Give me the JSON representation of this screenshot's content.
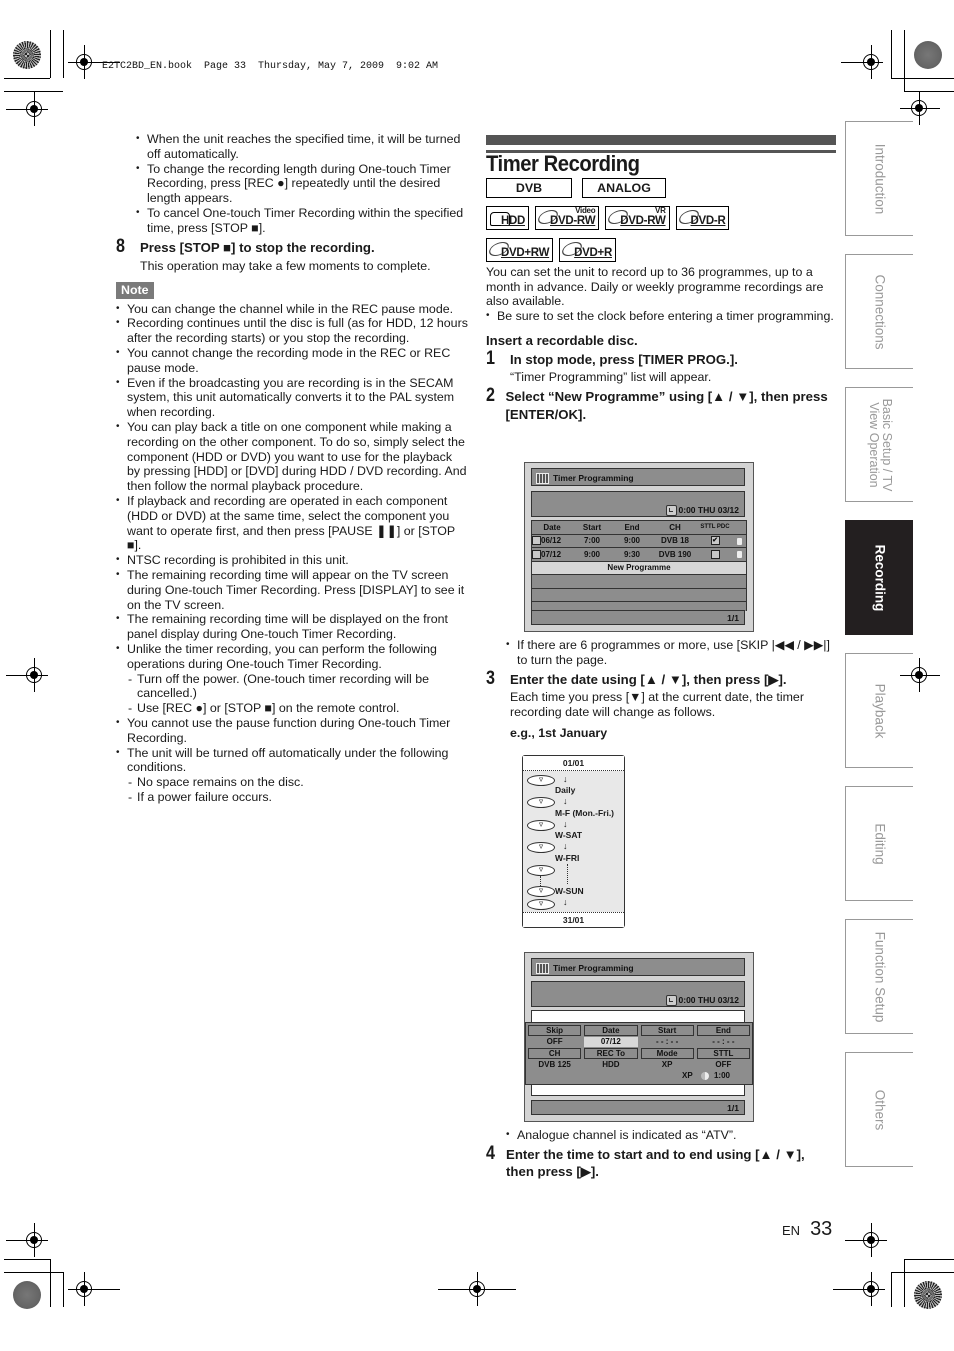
{
  "print_header": "E2TC2BD_EN.book  Page 33  Thursday, May 7, 2009  9:02 AM",
  "left_column": {
    "intro_bullets": [
      "When the unit reaches the specified time, it will be turned off automatically.",
      "To change the recording length during One-touch Timer Recording, press [REC ●] repeatedly until the desired length appears.",
      "To cancel One-touch Timer Recording within the specified time, press [STOP ■]."
    ],
    "step8": {
      "number": "8",
      "title": "Press [STOP ■] to stop the recording.",
      "body": "This operation may take a few moments to complete."
    },
    "note_label": "Note",
    "notes": [
      {
        "text": "You can change the channel while in the REC pause mode."
      },
      {
        "text": "Recording continues until the disc is full (as for HDD, 12 hours after the recording starts) or you stop the recording."
      },
      {
        "text": "You cannot change the recording mode in the REC or REC pause mode."
      },
      {
        "text": "Even if the broadcasting you are recording is in the SECAM system, this unit automatically converts it to the PAL system when recording."
      },
      {
        "text": "You can play back a title on one component while making a recording on the other component. To do so, simply select the component (HDD or DVD) you want to use for the playback by pressing [HDD] or [DVD] during HDD / DVD recording. And then follow the normal playback procedure."
      },
      {
        "text": "If playback and recording are operated in each component (HDD or DVD) at the same time, select the component you want to operate first, and then press [PAUSE ❚❚] or [STOP ■]."
      },
      {
        "text": "NTSC recording is prohibited in this unit."
      },
      {
        "text": "The remaining recording time will appear on the TV screen during One-touch Timer Recording. Press [DISPLAY] to see it on the TV screen."
      },
      {
        "text": "The remaining recording time will be displayed on the front panel display during One-touch Timer Recording."
      },
      {
        "text": "Unlike the timer recording, you can perform the following operations during One-touch Timer Recording.",
        "subs": [
          "Turn off the power. (One-touch timer recording will be cancelled.)",
          "Use [REC ●] or [STOP ■] on the remote control."
        ]
      },
      {
        "text": "You cannot use the pause function during One-touch Timer Recording."
      },
      {
        "text": "The unit will be turned off automatically under the following conditions.",
        "subs": [
          "No space remains on the disc.",
          "If a power failure occurs."
        ]
      }
    ]
  },
  "right_column": {
    "title": "Timer Recording",
    "tags": [
      "DVB",
      "ANALOG"
    ],
    "media": [
      {
        "label": "HDD",
        "sup": ""
      },
      {
        "label": "DVD-RW",
        "sup": "Video"
      },
      {
        "label": "DVD-RW",
        "sup": "VR"
      },
      {
        "label": "DVD-R",
        "sup": ""
      },
      {
        "label": "DVD+RW",
        "sup": ""
      },
      {
        "label": "DVD+R",
        "sup": ""
      }
    ],
    "intro": "You can set the unit to record up to 36 programmes, up to a month in advance. Daily or weekly programme recordings are also available.",
    "intro_bullet": "Be sure to set the clock before entering a timer programming.",
    "insert_disc": "Insert a recordable disc.",
    "step1": {
      "number": "1",
      "title": "In stop mode, press [TIMER PROG.].",
      "body": "“Timer Programming” list will appear."
    },
    "step2": {
      "number": "2",
      "title": "Select “New Programme” using [▲ / ▼], then press [ENTER/OK]."
    },
    "step2_bullet": "If there are 6 programmes or more, use [SKIP |◀◀ / ▶▶|] to turn the page.",
    "step3": {
      "number": "3",
      "title": "Enter the date using [▲ / ▼], then press [▶].",
      "body": "Each time you press [▼] at the current date, the timer recording date will change as follows."
    },
    "example_label": "e.g., 1st January",
    "step3_bullet": "Analogue channel is indicated as “ATV”.",
    "step4": {
      "number": "4",
      "title": "Enter the time to start and to end using [▲ / ▼], then press [▶]."
    }
  },
  "screen1": {
    "title": "Timer Programming",
    "clock": "0:00 THU 03/12",
    "columns": [
      "Date",
      "Start",
      "End",
      "CH",
      "STTL PDC"
    ],
    "rows": [
      {
        "date": "06/12",
        "start": "7:00",
        "end": "9:00",
        "ch": "DVB 18",
        "sttl_checked": true
      },
      {
        "date": "07/12",
        "start": "9:00",
        "end": "9:30",
        "ch": "DVB 190",
        "sttl_checked": false
      }
    ],
    "new_programme": "New Programme",
    "page": "1/1"
  },
  "date_cycle": {
    "start": "01/01",
    "options": [
      "Daily",
      "M-F (Mon.-Fri.)",
      "W-SAT",
      "W-FRI",
      "W-SUN"
    ],
    "end": "31/01"
  },
  "screen2": {
    "title": "Timer Programming",
    "clock": "0:00 THU 03/12",
    "fields_row1": [
      {
        "label": "Skip",
        "value": "OFF"
      },
      {
        "label": "Date",
        "value": "07/12"
      },
      {
        "label": "Start",
        "value": "- - : - -"
      },
      {
        "label": "End",
        "value": "- - : - -"
      }
    ],
    "fields_row2": [
      {
        "label": "CH",
        "value": "DVB 125"
      },
      {
        "label": "REC To",
        "value": "HDD"
      },
      {
        "label": "Mode",
        "value": "XP"
      },
      {
        "label": "STTL",
        "value": "OFF"
      }
    ],
    "remaining_mode": "XP",
    "remaining_time": "1:00",
    "page": "1/1"
  },
  "side_tabs": [
    {
      "label": "Introduction",
      "active": false
    },
    {
      "label": "Connections",
      "active": false
    },
    {
      "label": "Basic Setup / TV View Operation",
      "active": false
    },
    {
      "label": "Recording",
      "active": true
    },
    {
      "label": "Playback",
      "active": false
    },
    {
      "label": "Editing",
      "active": false
    },
    {
      "label": "Function Setup",
      "active": false
    },
    {
      "label": "Others",
      "active": false
    }
  ],
  "footer": {
    "lang": "EN",
    "page_number": "33"
  }
}
